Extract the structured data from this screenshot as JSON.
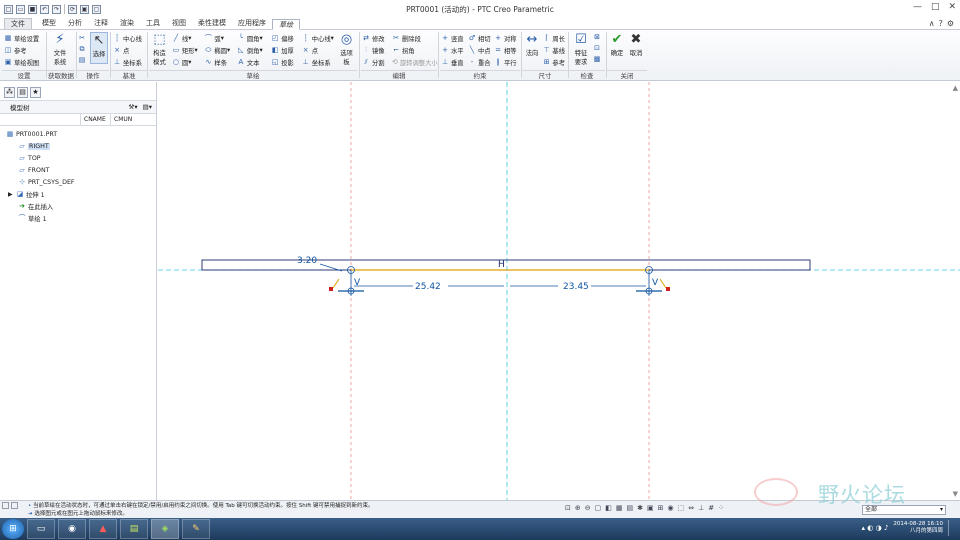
{
  "window": {
    "title": "PRT0001 (活动的) - PTC Creo Parametric",
    "controls": [
      "—",
      "□",
      "✕"
    ]
  },
  "qat_icons": [
    "new-icon",
    "open-icon",
    "save-icon",
    "undo-icon",
    "redo-icon",
    "regenerate-icon",
    "windows-icon",
    "close-window-icon"
  ],
  "tabs": [
    "文件",
    "模型",
    "分析",
    "注释",
    "渲染",
    "工具",
    "视图",
    "柔性建模",
    "应用程序",
    "草绘"
  ],
  "active_tab": "草绘",
  "ribbon": {
    "setup": {
      "items": [
        "草绘设置",
        "参考",
        "草绘视图"
      ],
      "label": "设置"
    },
    "get_data": {
      "button": "文件\n系统",
      "label": "获取数据"
    },
    "operations": {
      "button": "选择",
      "label": "操作"
    },
    "datum": {
      "items": [
        "中心线",
        "点",
        "坐标系"
      ],
      "label": "基准"
    },
    "sketch": {
      "big": "构造\n模式",
      "col1": [
        "线",
        "矩形",
        "圆"
      ],
      "col2": [
        "弧",
        "椭圆",
        "样条"
      ],
      "col3": [
        "圆角",
        "倒角",
        "文本"
      ],
      "col4": [
        "偏移",
        "加厚",
        "投影"
      ],
      "col5": [
        "中心线",
        "点",
        "坐标系"
      ],
      "palette": "选项\n板",
      "label": "草绘"
    },
    "edit": {
      "items": [
        "修改",
        "删除段",
        "镜像",
        "拐角",
        "分割",
        "旋转调整大小"
      ],
      "label": "编辑"
    },
    "constrain": {
      "items": [
        "竖直",
        "相切",
        "对称",
        "水平",
        "中点",
        "相等",
        "垂直",
        "重合",
        "平行"
      ],
      "label": "约束"
    },
    "dimension": {
      "big": "法向",
      "items": [
        "周长",
        "基线",
        "参考"
      ],
      "label": "尺寸"
    },
    "inspect": {
      "big": "特征\n要求",
      "label": "检查"
    },
    "close": {
      "ok": "确定",
      "cancel": "取消",
      "label": "关闭"
    }
  },
  "model_tree": {
    "title": "模型树",
    "columns": [
      "CNAME",
      "CMUN"
    ],
    "items": [
      {
        "label": "PRT0001.PRT",
        "icon": "part-icon"
      },
      {
        "label": "RIGHT",
        "icon": "datum-plane-icon"
      },
      {
        "label": "TOP",
        "icon": "datum-plane-icon"
      },
      {
        "label": "FRONT",
        "icon": "datum-plane-icon"
      },
      {
        "label": "PRT_CSYS_DEF",
        "icon": "csys-icon"
      },
      {
        "label": "拉伸 1",
        "icon": "extrude-icon"
      },
      {
        "label": "在此插入",
        "icon": "insert-arrow-icon"
      },
      {
        "label": "草绘 1",
        "icon": "sketch-icon"
      }
    ]
  },
  "sketch": {
    "dims": [
      "3.20",
      "25.42",
      "23.45"
    ],
    "constraint_h": "H",
    "constraint_v1": "V",
    "constraint_v2": "V"
  },
  "status": {
    "line1": "当前草绘在活动状态时，可通过单击右键在锁定/禁用/启用约束之间切换。使用 Tab 键可切换活动约束。按住 Shift 键可禁用捕捉到新约束。",
    "line2": "选择图元或在图元上拖动鼠标来修改。",
    "filter": "全部"
  },
  "clock": {
    "time": "16:10",
    "date": "2014-08-28",
    "weekday": "八月的第四周"
  },
  "watermark": "野火论坛",
  "colors": {
    "accent": "#2a5da8",
    "sketch_dim": "#0f55a0",
    "sketch_line": "#e0a000"
  }
}
